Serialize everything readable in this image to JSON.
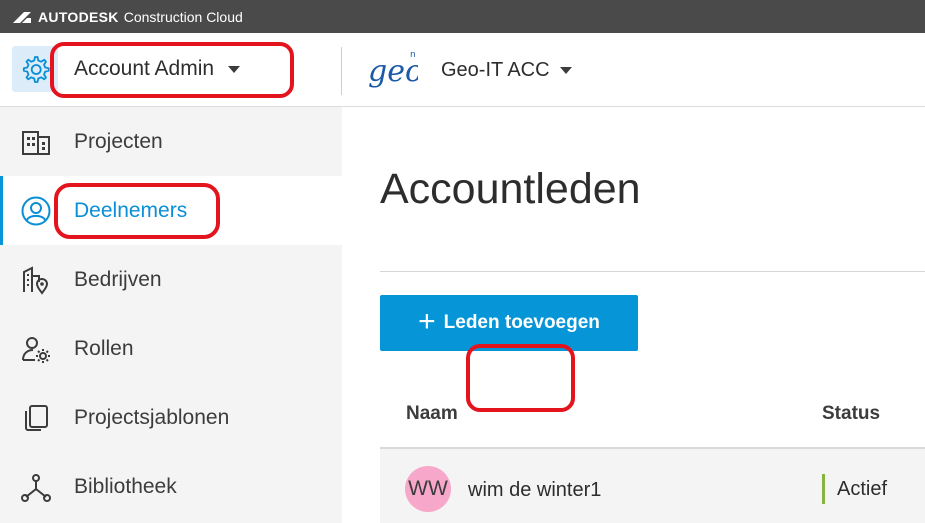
{
  "topbar": {
    "brand": "AUTODESK",
    "product": "Construction Cloud"
  },
  "header": {
    "account_label": "Account Admin",
    "project_logo": "geo",
    "project_label": "Geo-IT ACC"
  },
  "sidebar": {
    "items": [
      {
        "label": "Projecten",
        "icon": "buildings-icon"
      },
      {
        "label": "Deelnemers",
        "icon": "user-circle-icon",
        "active": true
      },
      {
        "label": "Bedrijven",
        "icon": "company-location-icon"
      },
      {
        "label": "Rollen",
        "icon": "user-gear-icon"
      },
      {
        "label": "Projectsjablonen",
        "icon": "copy-template-icon"
      },
      {
        "label": "Bibliotheek",
        "icon": "library-nodes-icon"
      }
    ]
  },
  "main": {
    "title": "Accountleden",
    "add_button": "Leden toevoegen",
    "columns": {
      "name": "Naam",
      "status": "Status"
    },
    "rows": [
      {
        "initials": "WW",
        "name": "wim de winter1",
        "status": "Actief"
      }
    ]
  },
  "colors": {
    "accent": "#0696d7",
    "highlight": "#e4141e",
    "status_active": "#87b340",
    "avatar": "#f7a7c9"
  }
}
